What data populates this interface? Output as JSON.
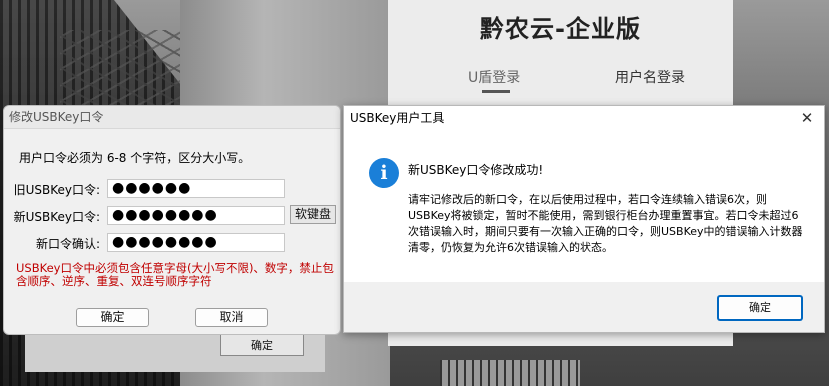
{
  "login": {
    "title": "黔农云-企业版",
    "tab_usb": "U盾登录",
    "tab_username": "用户名登录",
    "bg_ok_label": "确定"
  },
  "change_dialog": {
    "title": "修改USBKey口令",
    "hint": "用户口令必须为 6-8 个字符，区分大小写。",
    "old_label": "旧USBKey口令:",
    "old_value": "●●●●●●",
    "new_label": "新USBKey口令:",
    "new_value": "●●●●●●●●",
    "confirm_label": "新口令确认:",
    "confirm_value": "●●●●●●●●",
    "softkb_label": "软键盘",
    "rule_text": "USBKey口令中必须包含任意字母(大小写不限)、数字，禁止包含顺序、逆序、重复、双连号顺序字符",
    "ok_label": "确定",
    "cancel_label": "取消"
  },
  "tool_dialog": {
    "title": "USBKey用户工具",
    "close_glyph": "✕",
    "icon_glyph": "i",
    "message_title": "新USBKey口令修改成功!",
    "message_body": "请牢记修改后的新口令，在以后使用过程中，若口令连续输入错误6次，则USBKey将被锁定，暂时不能使用，需到银行柜台办理重置事宜。若口令未超过6次错误输入时，期间只要有一次输入正确的口令，则USBKey中的错误输入计数器清零，仍恢复为允许6次错误输入的状态。",
    "ok_label": "确定"
  },
  "colors": {
    "accent": "#0067c0",
    "info_icon": "#1a7fd8",
    "warning_text": "#c00000"
  }
}
